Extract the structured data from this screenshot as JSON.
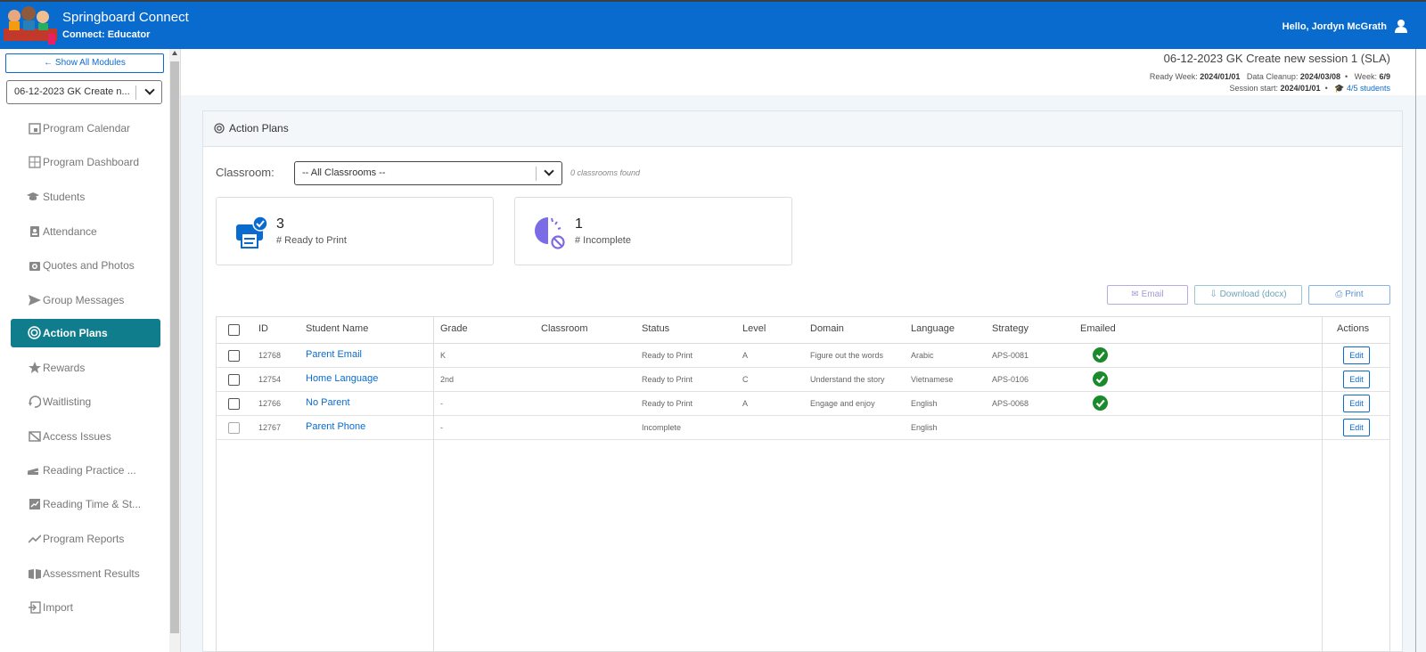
{
  "header": {
    "app_title": "Springboard Connect",
    "app_subtitle": "Connect: Educator",
    "greeting": "Hello, Jordyn McGrath"
  },
  "sidebar": {
    "show_all": "Show All Modules",
    "session_select": "06-12-2023 GK Create n...",
    "items": [
      {
        "label": "Program Calendar",
        "icon": "calendar-icon"
      },
      {
        "label": "Program Dashboard",
        "icon": "dashboard-icon"
      },
      {
        "label": "Students",
        "icon": "graduation-cap-icon"
      },
      {
        "label": "Attendance",
        "icon": "attendance-icon"
      },
      {
        "label": "Quotes and Photos",
        "icon": "camera-icon"
      },
      {
        "label": "Group Messages",
        "icon": "send-icon"
      },
      {
        "label": "Action Plans",
        "icon": "target-icon",
        "active": true
      },
      {
        "label": "Rewards",
        "icon": "rewards-icon"
      },
      {
        "label": "Waitlisting",
        "icon": "waitlist-icon"
      },
      {
        "label": "Access Issues",
        "icon": "access-icon"
      },
      {
        "label": "Reading Practice ...",
        "icon": "books-icon"
      },
      {
        "label": "Reading Time & St...",
        "icon": "chart-box-icon"
      },
      {
        "label": "Program Reports",
        "icon": "trend-icon"
      },
      {
        "label": "Assessment Results",
        "icon": "book-open-icon"
      },
      {
        "label": "Import",
        "icon": "import-icon"
      }
    ]
  },
  "session": {
    "title": "06-12-2023 GK Create new session 1 (SLA)",
    "ready_week_label": "Ready Week:",
    "ready_week": "2024/01/01",
    "data_cleanup_label": "Data Cleanup:",
    "data_cleanup": "2024/03/08",
    "week_label": "Week:",
    "week": "6/9",
    "session_start_label": "Session start:",
    "session_start": "2024/01/01",
    "students": "4/5 students"
  },
  "panel": {
    "title": "Action Plans",
    "classroom_label": "Classroom:",
    "classroom_value": "-- All Classrooms --",
    "classrooms_found": "0 classrooms found",
    "stats": [
      {
        "value": "3",
        "label": "# Ready to Print"
      },
      {
        "value": "1",
        "label": "# Incomplete"
      }
    ],
    "buttons": {
      "email": "Email",
      "download": "Download (docx)",
      "print": "Print"
    }
  },
  "table": {
    "columns": [
      "ID",
      "Student Name",
      "Grade",
      "Classroom",
      "Status",
      "Level",
      "Domain",
      "Language",
      "Strategy",
      "Emailed",
      "Actions"
    ],
    "rows": [
      {
        "id": "12768",
        "name": "Parent Email",
        "grade": "K",
        "classroom": "",
        "status": "Ready to Print",
        "level": "A",
        "domain": "Figure out the words",
        "language": "Arabic",
        "strategy": "APS-0081",
        "emailed": true,
        "action": "Edit"
      },
      {
        "id": "12754",
        "name": "Home Language",
        "grade": "2nd",
        "classroom": "",
        "status": "Ready to Print",
        "level": "C",
        "domain": "Understand the story",
        "language": "Vietnamese",
        "strategy": "APS-0106",
        "emailed": true,
        "action": "Edit"
      },
      {
        "id": "12766",
        "name": "No Parent",
        "grade": "-",
        "classroom": "",
        "status": "Ready to Print",
        "level": "A",
        "domain": "Engage and enjoy",
        "language": "English",
        "strategy": "APS-0068",
        "emailed": true,
        "action": "Edit"
      },
      {
        "id": "12767",
        "name": "Parent Phone",
        "grade": "-",
        "classroom": "",
        "status": "Incomplete",
        "level": "",
        "domain": "",
        "language": "English",
        "strategy": "",
        "emailed": false,
        "action": "Edit"
      }
    ]
  },
  "colors": {
    "brand": "#0a6bcf",
    "active_nav": "#0f7d8c",
    "check_green": "#1a8a2a",
    "incomplete_purple": "#7b6be6"
  }
}
